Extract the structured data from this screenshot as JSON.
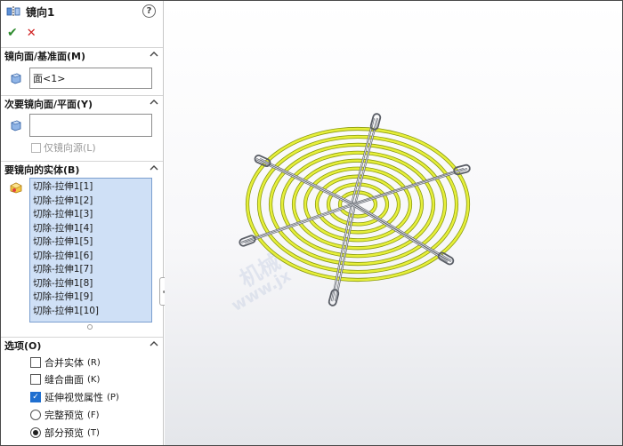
{
  "header": {
    "title": "镜向1",
    "help_label": "?",
    "ok_label": "✔",
    "cancel_label": "✕"
  },
  "mirror_face": {
    "heading": "镜向面/基准面(M)",
    "value": "面<1>"
  },
  "secondary_face": {
    "heading": "次要镜向面/平面(Y)",
    "value": "",
    "mirror_source_label": "仅镜向源(L)"
  },
  "bodies": {
    "heading": "要镜向的实体(B)",
    "items": [
      "切除-拉伸1[1]",
      "切除-拉伸1[2]",
      "切除-拉伸1[3]",
      "切除-拉伸1[4]",
      "切除-拉伸1[5]",
      "切除-拉伸1[6]",
      "切除-拉伸1[7]",
      "切除-拉伸1[8]",
      "切除-拉伸1[9]",
      "切除-拉伸1[10]"
    ]
  },
  "options": {
    "heading": "选项(O)",
    "merge_solids": {
      "label": "合并实体",
      "hotkey": "(R)",
      "checked": false
    },
    "knit_surfaces": {
      "label": "缝合曲面",
      "hotkey": "(K)",
      "checked": false
    },
    "propagate_visual": {
      "label": "延伸视觉属性",
      "hotkey": "(P)",
      "checked": true
    },
    "full_preview": {
      "label": "完整预览",
      "hotkey": "(F)",
      "selected": false
    },
    "partial_preview": {
      "label": "部分预览",
      "hotkey": "(T)",
      "selected": true
    }
  },
  "watermark": {
    "line1": "机械",
    "line2": "www.jx"
  },
  "colors": {
    "ring": "#e6ef3a",
    "ring_edge": "#8a9a10",
    "spoke": "#9aa0a8",
    "selection_bg": "#cfe0f6"
  }
}
